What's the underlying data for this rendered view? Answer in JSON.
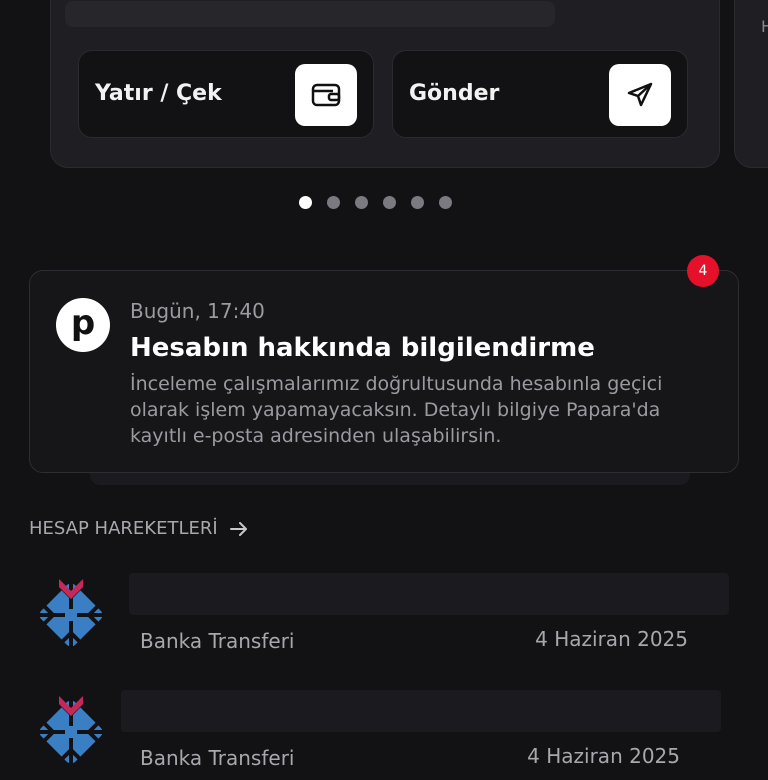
{
  "balance_card": {
    "actions": [
      {
        "label": "Yatır / Çek",
        "icon": "wallet-icon"
      },
      {
        "label": "Gönder",
        "icon": "send-icon"
      }
    ],
    "next_card_partial": "H",
    "pager": {
      "count": 6,
      "active_index": 0
    }
  },
  "notification": {
    "badge_count": "4",
    "logo_letter": "p",
    "time": "Bugün, 17:40",
    "title": "Hesabın hakkında bilgilendirme",
    "body": "İnceleme çalışmalarımız doğrultusunda hesabınla geçici olarak işlem yapamayacaksın. Detaylı bilgiye Papara'da kayıtlı e-posta adresinden ulaşabilirsin."
  },
  "transactions_section": {
    "title": "HESAP HAREKETLERİ",
    "items": [
      {
        "type": "Banka Transferi",
        "date": "4 Haziran 2025",
        "icon": "bank-logo-icon"
      },
      {
        "type": "Banka Transferi",
        "date": "4 Haziran 2025",
        "icon": "bank-logo-icon"
      }
    ]
  },
  "colors": {
    "background": "#121215",
    "badge": "#e5102a",
    "bank_logo_blue": "#1f8fd6",
    "bank_logo_red": "#c5285a"
  }
}
